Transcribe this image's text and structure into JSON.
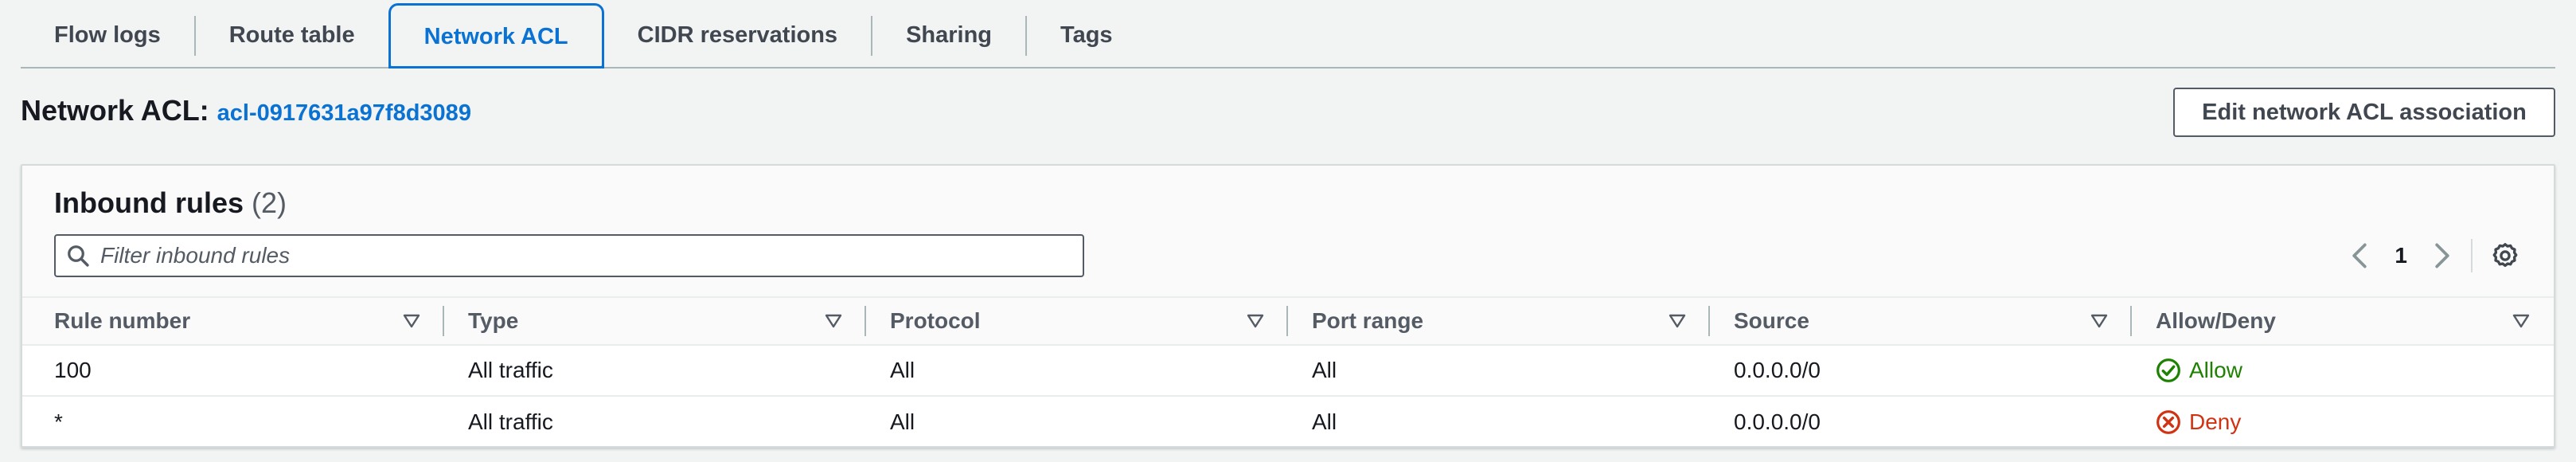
{
  "tabs": [
    {
      "label": "Flow logs",
      "active": false
    },
    {
      "label": "Route table",
      "active": false
    },
    {
      "label": "Network ACL",
      "active": true
    },
    {
      "label": "CIDR reservations",
      "active": false
    },
    {
      "label": "Sharing",
      "active": false
    },
    {
      "label": "Tags",
      "active": false
    }
  ],
  "header": {
    "label": "Network ACL:",
    "acl_id": "acl-0917631a97f8d3089",
    "edit_button": "Edit network ACL association"
  },
  "panel": {
    "title": "Inbound rules",
    "count": "(2)",
    "filter_placeholder": "Filter inbound rules",
    "page": "1"
  },
  "table": {
    "columns": [
      "Rule number",
      "Type",
      "Protocol",
      "Port range",
      "Source",
      "Allow/Deny"
    ],
    "rows": [
      {
        "rule_number": "100",
        "type": "All traffic",
        "protocol": "All",
        "port_range": "All",
        "source": "0.0.0.0/0",
        "action": "Allow",
        "status": "allow"
      },
      {
        "rule_number": "*",
        "type": "All traffic",
        "protocol": "All",
        "port_range": "All",
        "source": "0.0.0.0/0",
        "action": "Deny",
        "status": "deny"
      }
    ]
  },
  "colors": {
    "link": "#0972d3",
    "allow": "#1d8102",
    "deny": "#d13212"
  },
  "icons": [
    "search-icon",
    "chevron-left-icon",
    "chevron-right-icon",
    "settings-gear-icon",
    "sort-caret-icon",
    "check-circle-icon",
    "x-circle-icon"
  ]
}
